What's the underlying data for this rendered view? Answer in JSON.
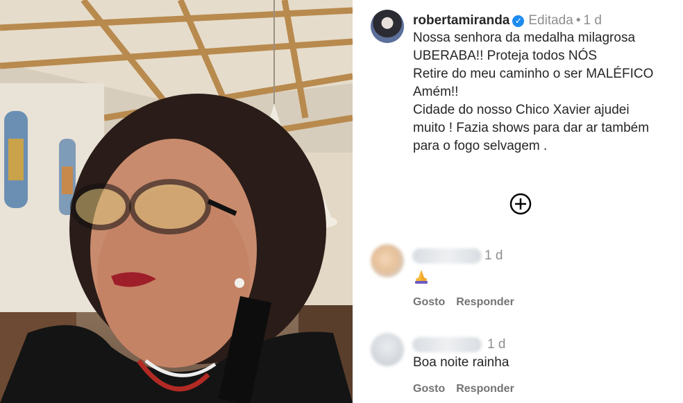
{
  "post": {
    "username": "robertamiranda",
    "verified_icon": "verified-badge-icon",
    "edited_label": "Editada",
    "separator": "•",
    "time": "1 d",
    "caption_lines": [
      "Nossa senhora da medalha milagrosa",
      "UBERABA!! Proteja todos NÓS",
      "Retire do meu caminho o ser MALÉFICO",
      "Amém!!",
      "Cidade do nosso Chico Xavier  ajudei",
      "muito ! Fazia shows para dar ar também",
      "para o fogo selvagem ."
    ],
    "more_comments_icon": "plus-circle-icon"
  },
  "comments": [
    {
      "time": "1 d",
      "emoji": "folded-hands-icon",
      "like_label": "Gosto",
      "reply_label": "Responder"
    },
    {
      "time": "1 d",
      "text": "Boa noite rainha",
      "like_label": "Gosto",
      "reply_label": "Responder"
    }
  ],
  "colors": {
    "text": "#262626",
    "muted": "#8e8e8e",
    "verified": "#1d8cf0"
  }
}
